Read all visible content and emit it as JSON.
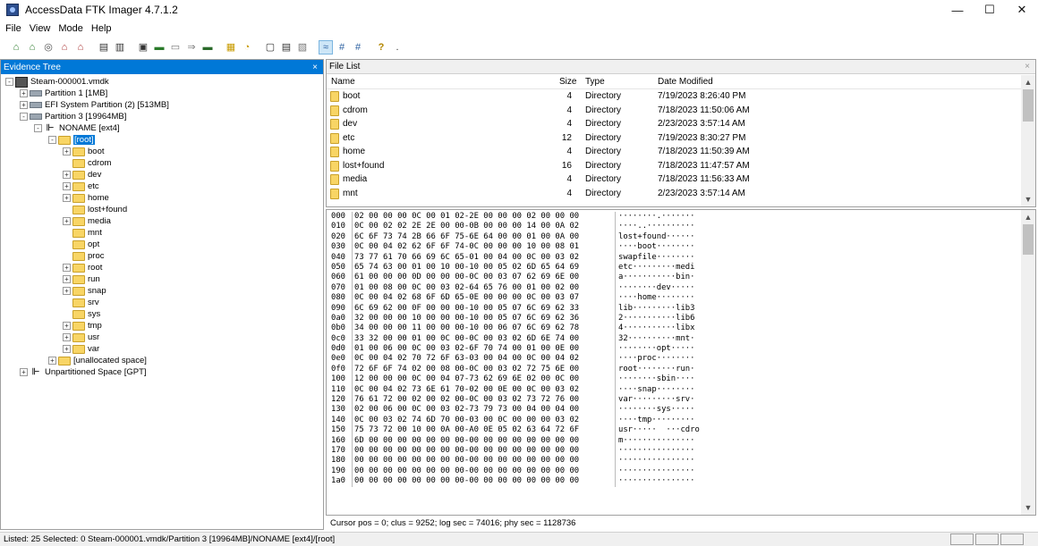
{
  "window": {
    "title": "AccessData FTK Imager 4.7.1.2",
    "controls": {
      "minimize": "—",
      "maximize": "☐",
      "close": "✕"
    }
  },
  "menu": [
    "File",
    "View",
    "Mode",
    "Help"
  ],
  "toolbar": {
    "icons": [
      "add-evidence-icon",
      "add-all-attached-icon",
      "image-mounting-icon",
      "remove-evidence-icon",
      "remove-all-evidence-icon",
      "create-disk-image-icon",
      "export-disk-image-icon",
      "export-logical-image-icon",
      "add-to-custom-content-icon",
      "create-custom-content-icon",
      "decrypt-icon",
      "capture-memory-icon",
      "export-files-icon",
      "export-hash-list-icon",
      "verify-drive-icon",
      "view-files-icon",
      "auto-view-icon",
      "text-view-icon",
      "hex-view-icon",
      "help-icon"
    ]
  },
  "evidence_tree": {
    "title": "Evidence Tree",
    "close": "×",
    "items": [
      {
        "label": "Steam-000001.vmdk",
        "indent": 0,
        "exp": "-",
        "icon": "image"
      },
      {
        "label": "Partition 1 [1MB]",
        "indent": 1,
        "exp": "+",
        "icon": "drive"
      },
      {
        "label": "EFI System Partition (2) [513MB]",
        "indent": 1,
        "exp": "+",
        "icon": "drive"
      },
      {
        "label": "Partition 3 [19964MB]",
        "indent": 1,
        "exp": "-",
        "icon": "drive"
      },
      {
        "label": "NONAME [ext4]",
        "indent": 2,
        "exp": "-",
        "icon": "fs"
      },
      {
        "label": "[root]",
        "indent": 3,
        "exp": "-",
        "icon": "folder",
        "selected": true
      },
      {
        "label": "boot",
        "indent": 4,
        "exp": "+",
        "icon": "folder"
      },
      {
        "label": "cdrom",
        "indent": 4,
        "exp": "",
        "icon": "folder"
      },
      {
        "label": "dev",
        "indent": 4,
        "exp": "+",
        "icon": "folder"
      },
      {
        "label": "etc",
        "indent": 4,
        "exp": "+",
        "icon": "folder"
      },
      {
        "label": "home",
        "indent": 4,
        "exp": "+",
        "icon": "folder"
      },
      {
        "label": "lost+found",
        "indent": 4,
        "exp": "",
        "icon": "folder"
      },
      {
        "label": "media",
        "indent": 4,
        "exp": "+",
        "icon": "folder"
      },
      {
        "label": "mnt",
        "indent": 4,
        "exp": "",
        "icon": "folder"
      },
      {
        "label": "opt",
        "indent": 4,
        "exp": "",
        "icon": "folder"
      },
      {
        "label": "proc",
        "indent": 4,
        "exp": "",
        "icon": "folder"
      },
      {
        "label": "root",
        "indent": 4,
        "exp": "+",
        "icon": "folder"
      },
      {
        "label": "run",
        "indent": 4,
        "exp": "+",
        "icon": "folder"
      },
      {
        "label": "snap",
        "indent": 4,
        "exp": "+",
        "icon": "folder"
      },
      {
        "label": "srv",
        "indent": 4,
        "exp": "",
        "icon": "folder"
      },
      {
        "label": "sys",
        "indent": 4,
        "exp": "",
        "icon": "folder"
      },
      {
        "label": "tmp",
        "indent": 4,
        "exp": "+",
        "icon": "folder"
      },
      {
        "label": "usr",
        "indent": 4,
        "exp": "+",
        "icon": "folder"
      },
      {
        "label": "var",
        "indent": 4,
        "exp": "+",
        "icon": "folder"
      },
      {
        "label": "[unallocated space]",
        "indent": 3,
        "exp": "+",
        "icon": "folder"
      },
      {
        "label": "Unpartitioned Space [GPT]",
        "indent": 1,
        "exp": "+",
        "icon": "fs"
      }
    ]
  },
  "file_list": {
    "title": "File List",
    "close": "×",
    "columns": {
      "name": "Name",
      "size": "Size",
      "type": "Type",
      "date": "Date Modified"
    },
    "rows": [
      {
        "name": "boot",
        "size": "4",
        "type": "Directory",
        "date": "7/19/2023 8:26:40 PM"
      },
      {
        "name": "cdrom",
        "size": "4",
        "type": "Directory",
        "date": "7/18/2023 11:50:06 AM"
      },
      {
        "name": "dev",
        "size": "4",
        "type": "Directory",
        "date": "2/23/2023 3:57:14 AM"
      },
      {
        "name": "etc",
        "size": "12",
        "type": "Directory",
        "date": "7/19/2023 8:30:27 PM"
      },
      {
        "name": "home",
        "size": "4",
        "type": "Directory",
        "date": "7/18/2023 11:50:39 AM"
      },
      {
        "name": "lost+found",
        "size": "16",
        "type": "Directory",
        "date": "7/18/2023 11:47:57 AM"
      },
      {
        "name": "media",
        "size": "4",
        "type": "Directory",
        "date": "7/18/2023 11:56:33 AM"
      },
      {
        "name": "mnt",
        "size": "4",
        "type": "Directory",
        "date": "2/23/2023 3:57:14 AM"
      }
    ]
  },
  "hex_view": {
    "rows": [
      {
        "off": "000",
        "bytes": "02 00 00 00 0C 00 01 02-2E 00 00 00 02 00 00 00",
        "ascii": "········.·······"
      },
      {
        "off": "010",
        "bytes": "0C 00 02 02 2E 2E 00 00-0B 00 00 00 14 00 0A 02",
        "ascii": "····..··········"
      },
      {
        "off": "020",
        "bytes": "6C 6F 73 74 2B 66 6F 75-6E 64 00 00 01 00 0A 00",
        "ascii": "lost+found······"
      },
      {
        "off": "030",
        "bytes": "0C 00 04 02 62 6F 6F 74-0C 00 00 00 10 00 08 01",
        "ascii": "····boot········"
      },
      {
        "off": "040",
        "bytes": "73 77 61 70 66 69 6C 65-01 00 04 00 0C 00 03 02",
        "ascii": "swapfile········"
      },
      {
        "off": "050",
        "bytes": "65 74 63 00 01 00 10 00-10 00 05 02 6D 65 64 69",
        "ascii": "etc·········medi"
      },
      {
        "off": "060",
        "bytes": "61 00 00 00 0D 00 00 00-0C 00 03 07 62 69 6E 00",
        "ascii": "a···········bin·"
      },
      {
        "off": "070",
        "bytes": "01 00 08 00 0C 00 03 02-64 65 76 00 01 00 02 00",
        "ascii": "········dev·····"
      },
      {
        "off": "080",
        "bytes": "0C 00 04 02 68 6F 6D 65-0E 00 00 00 0C 00 03 07",
        "ascii": "····home········"
      },
      {
        "off": "090",
        "bytes": "6C 69 62 00 0F 00 00 00-10 00 05 07 6C 69 62 33",
        "ascii": "lib·········lib3"
      },
      {
        "off": "0a0",
        "bytes": "32 00 00 00 10 00 00 00-10 00 05 07 6C 69 62 36",
        "ascii": "2···········lib6"
      },
      {
        "off": "0b0",
        "bytes": "34 00 00 00 11 00 00 00-10 00 06 07 6C 69 62 78",
        "ascii": "4···········libx"
      },
      {
        "off": "0c0",
        "bytes": "33 32 00 00 01 00 0C 00-0C 00 03 02 6D 6E 74 00",
        "ascii": "32··········mnt·"
      },
      {
        "off": "0d0",
        "bytes": "01 00 06 00 0C 00 03 02-6F 70 74 00 01 00 0E 00",
        "ascii": "········opt·····"
      },
      {
        "off": "0e0",
        "bytes": "0C 00 04 02 70 72 6F 63-03 00 04 00 0C 00 04 02",
        "ascii": "····proc········"
      },
      {
        "off": "0f0",
        "bytes": "72 6F 6F 74 02 00 08 00-0C 00 03 02 72 75 6E 00",
        "ascii": "root········run·"
      },
      {
        "off": "100",
        "bytes": "12 00 00 00 0C 00 04 07-73 62 69 6E 02 00 0C 00",
        "ascii": "········sbin····"
      },
      {
        "off": "110",
        "bytes": "0C 00 04 02 73 6E 61 70-02 00 0E 00 0C 00 03 02",
        "ascii": "····snap········"
      },
      {
        "off": "120",
        "bytes": "76 61 72 00 02 00 02 00-0C 00 03 02 73 72 76 00",
        "ascii": "var·········srv·"
      },
      {
        "off": "130",
        "bytes": "02 00 06 00 0C 00 03 02-73 79 73 00 04 00 04 00",
        "ascii": "········sys·····"
      },
      {
        "off": "140",
        "bytes": "0C 00 03 02 74 6D 70 00-03 00 0C 00 00 00 03 02",
        "ascii": "····tmp·········"
      },
      {
        "off": "150",
        "bytes": "75 73 72 00 10 00 0A 00-A0 0E 05 02 63 64 72 6F",
        "ascii": "usr·····  ···cdro"
      },
      {
        "off": "160",
        "bytes": "6D 00 00 00 00 00 00 00-00 00 00 00 00 00 00 00",
        "ascii": "m···············"
      },
      {
        "off": "170",
        "bytes": "00 00 00 00 00 00 00 00-00 00 00 00 00 00 00 00",
        "ascii": "················"
      },
      {
        "off": "180",
        "bytes": "00 00 00 00 00 00 00 00-00 00 00 00 00 00 00 00",
        "ascii": "················"
      },
      {
        "off": "190",
        "bytes": "00 00 00 00 00 00 00 00-00 00 00 00 00 00 00 00",
        "ascii": "················"
      },
      {
        "off": "1a0",
        "bytes": "00 00 00 00 00 00 00 00-00 00 00 00 00 00 00 00",
        "ascii": "················"
      }
    ],
    "cursor_info": "Cursor pos = 0; clus = 9252; log sec = 74016; phy sec = 1128736"
  },
  "status": {
    "text": "Listed: 25  Selected: 0  Steam-000001.vmdk/Partition 3 [19964MB]/NONAME [ext4]/[root]"
  },
  "colors": {
    "selection": "#0078d7",
    "folder": "#f8d565",
    "pane_border": "#a0a0a0"
  }
}
